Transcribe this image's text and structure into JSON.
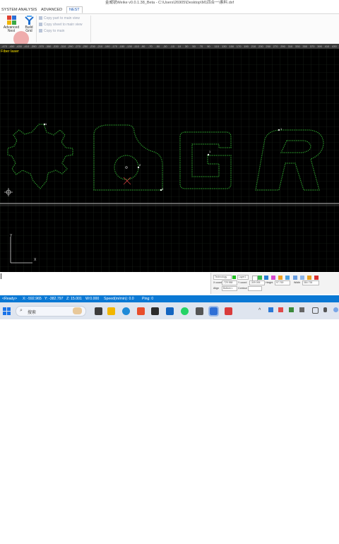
{
  "window": {
    "title": "金威锐Weike v0.0.1.38_Beta - C:\\Users\\26905\\Desktop\\M1四合一\\素料.dxf"
  },
  "tabs": [
    {
      "label": "SYSTEM ANALYSIS"
    },
    {
      "label": "ADVANCED"
    },
    {
      "label": "NEST"
    }
  ],
  "ribbon": {
    "advanced_nest_label_1": "Advanced",
    "advanced_nest_label_2": "Nest",
    "build_label_1": "Build",
    "build_label_2": "Grid",
    "copy_part": "Copy part to main view",
    "copy_sheet": "Copy sheet to main view",
    "copy_main": "Copy to main"
  },
  "ruler": {
    "ticks": [
      "-470",
      "-450",
      "-430",
      "-410",
      "-390",
      "-370",
      "-350",
      "-330",
      "-310",
      "-290",
      "-270",
      "-250",
      "-230",
      "-210",
      "-190",
      "-170",
      "-150",
      "-130",
      "-110",
      "-90",
      "-70",
      "-50",
      "-30",
      "-10",
      "10",
      "30",
      "50",
      "70",
      "90",
      "110",
      "130",
      "150",
      "170",
      "190",
      "210",
      "230",
      "250",
      "270",
      "290",
      "310",
      "330",
      "350",
      "370",
      "390",
      "410",
      "430",
      "450"
    ]
  },
  "canvas": {
    "layer_label": "Fiber laser",
    "axis_y": "Y",
    "axis_x": "X",
    "markers": {
      "gear": "1",
      "block": "3",
      "circle": "2",
      "g": "1",
      "r": "1"
    }
  },
  "properties": {
    "technology_label": "Technology",
    "layer_label": "Layer1",
    "x_coord_label": "X coord",
    "x_coord_value": "-729.988",
    "y_coord_label": "Y coord",
    "y_coord_value": "-309.006",
    "height_label": "Height",
    "height_value": "97.769",
    "width_label": "Width",
    "width_value": "384.738",
    "align_label": "Align",
    "align_value": "Bottom L",
    "contour_label": "Contour"
  },
  "status_bar": {
    "ready": "<Ready>",
    "x": "X: -592.965",
    "y": "Y: -382.797",
    "z": "Z: 15.001",
    "w": "W:0.000",
    "speed": "Speed(m/min): 0.0",
    "ping": "Ping: 0"
  },
  "taskbar": {
    "search_label": "搜索"
  },
  "colors": {
    "status_blue": "#0a78d4",
    "grid_green": "#2e8b2e",
    "layer_yellow": "#ffe600",
    "canvas_bg": "#000000"
  }
}
